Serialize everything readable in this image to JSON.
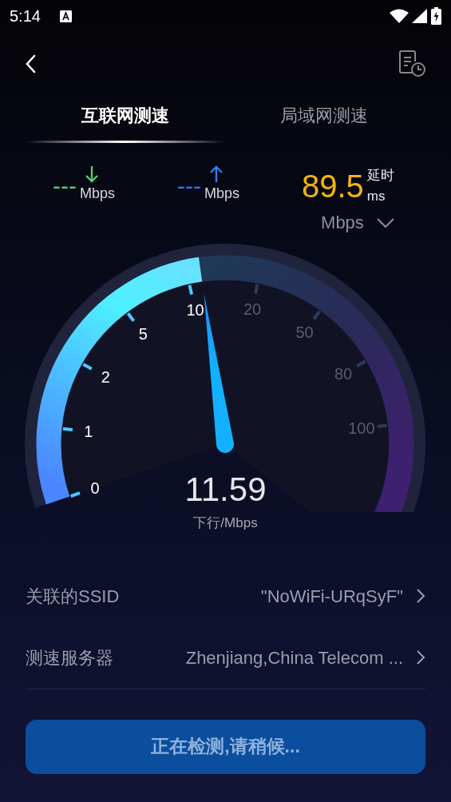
{
  "status_bar": {
    "time": "5:14"
  },
  "tabs": [
    {
      "label": "互联网测速",
      "selected": true
    },
    {
      "label": "局域网测速",
      "selected": false
    }
  ],
  "stats": {
    "download": {
      "value": "---",
      "unit": "Mbps"
    },
    "upload": {
      "value": "---",
      "unit": "Mbps"
    },
    "latency": {
      "value": "89.5",
      "label": "延时",
      "unit": "ms"
    }
  },
  "unit_selector": {
    "value": "Mbps"
  },
  "gauge": {
    "reading": "11.59",
    "caption": "下行/Mbps",
    "ticks": [
      {
        "label": "0",
        "active": true
      },
      {
        "label": "1",
        "active": true
      },
      {
        "label": "2",
        "active": true
      },
      {
        "label": "5",
        "active": true
      },
      {
        "label": "10",
        "active": true
      },
      {
        "label": "20",
        "active": false
      },
      {
        "label": "50",
        "active": false
      },
      {
        "label": "80",
        "active": false
      },
      {
        "label": "100",
        "active": false
      }
    ]
  },
  "info_rows": [
    {
      "label": "关联的SSID",
      "value": "\"NoWiFi-URqSyF\""
    },
    {
      "label": "测速服务器",
      "value": "Zhenjiang,China Telecom ..."
    }
  ],
  "button": {
    "label": "正在检测,请稍候...",
    "disabled": true
  }
}
